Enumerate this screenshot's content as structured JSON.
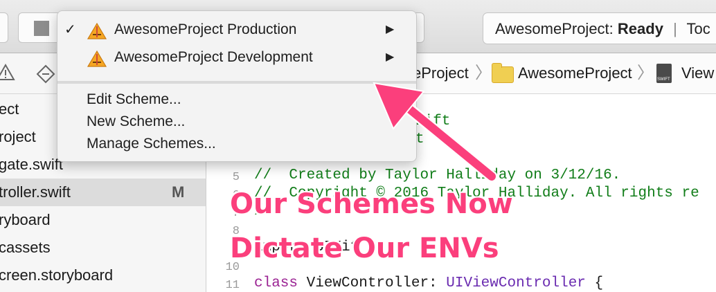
{
  "toolbar": {
    "activity_project": "AwesomeProject:",
    "activity_status": "Ready",
    "activity_extra": "Toc"
  },
  "scheme_menu": {
    "schemes": [
      {
        "label": "AwesomeProject Production",
        "checked": true
      },
      {
        "label": "AwesomeProject Development",
        "checked": false
      }
    ],
    "check_glyph": "✓",
    "submenu_glyph": "▶",
    "actions": [
      "Edit Scheme...",
      "New Scheme...",
      "Manage Schemes..."
    ]
  },
  "jumpbar": {
    "items": [
      "eProject",
      "AwesomeProject",
      "View"
    ],
    "chevron": "〉"
  },
  "navigator": {
    "rows": [
      {
        "label": "ect",
        "badge": ""
      },
      {
        "label": "roject",
        "badge": ""
      },
      {
        "label": "gate.swift",
        "badge": ""
      },
      {
        "label": "troller.swift",
        "badge": "M",
        "selected": true
      },
      {
        "label": "ryboard",
        "badge": ""
      },
      {
        "label": "cassets",
        "badge": ""
      },
      {
        "label": "creen.storyboard",
        "badge": ""
      }
    ]
  },
  "editor": {
    "lines": [
      {
        "num": "",
        "text": "wift"
      },
      {
        "num": "",
        "text": "t"
      },
      {
        "num": "",
        "text": "//"
      },
      {
        "num": "5",
        "text": "//  Created by Taylor Halliday on 3/12/16."
      },
      {
        "num": "6",
        "text": "//  Copyright © 2016 Taylor Halliday. All rights re"
      },
      {
        "num": "7",
        "text": "//"
      },
      {
        "num": "8",
        "text": ""
      },
      {
        "num": "9",
        "text": "import UIKit"
      },
      {
        "num": "10",
        "text": ""
      },
      {
        "num": "11",
        "keyword": "class",
        "name": " ViewController: ",
        "type": "UIViewController",
        "rest": " {"
      }
    ]
  },
  "annotation": {
    "line1": "Our Schemes Now",
    "line2": "Dictate Our ENVs",
    "color": "#fb3f7c"
  }
}
